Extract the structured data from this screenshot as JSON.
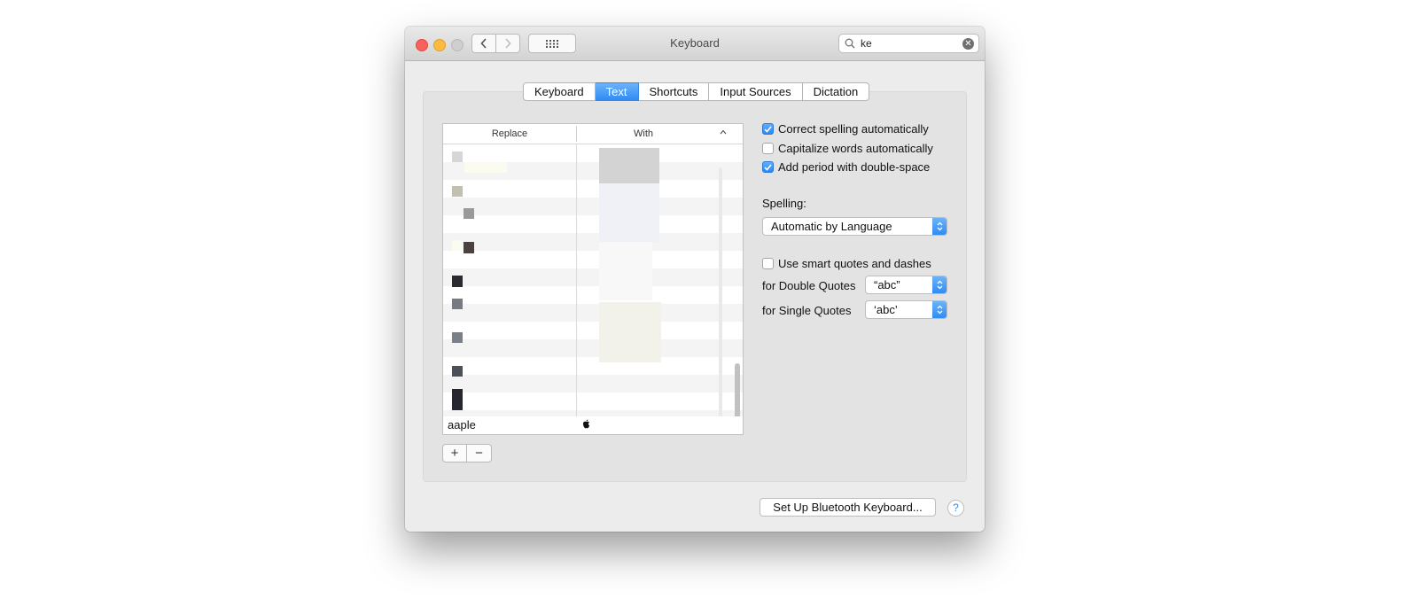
{
  "window": {
    "title": "Keyboard"
  },
  "toolbar": {
    "search_value": "ke",
    "back_icon": "chevron-left-icon",
    "forward_icon": "chevron-right-icon",
    "grid_icon": "show-all-grid-icon"
  },
  "tabs": [
    {
      "label": "Keyboard",
      "active": false
    },
    {
      "label": "Text",
      "active": true
    },
    {
      "label": "Shortcuts",
      "active": false
    },
    {
      "label": "Input Sources",
      "active": false
    },
    {
      "label": "Dictation",
      "active": false
    }
  ],
  "table": {
    "columns": [
      "Replace",
      "With"
    ],
    "last_row": {
      "replace": "aaple",
      "with_icon": "apple-logo-icon"
    }
  },
  "options": {
    "correct_spelling": {
      "label": "Correct spelling automatically",
      "checked": true
    },
    "capitalize_words": {
      "label": "Capitalize words automatically",
      "checked": false
    },
    "add_period": {
      "label": "Add period with double-space",
      "checked": true
    }
  },
  "spelling": {
    "label": "Spelling:",
    "value": "Automatic by Language"
  },
  "quotes": {
    "smart_quotes": {
      "label": "Use smart quotes and dashes",
      "checked": false
    },
    "double_label": "for Double Quotes",
    "double_value": "“abc”",
    "single_label": "for Single Quotes",
    "single_value": "‘abc’"
  },
  "buttons": {
    "bluetooth": "Set Up Bluetooth Keyboard...",
    "help": "?",
    "add": "+",
    "remove": "−"
  },
  "colors": {
    "accent": "#2f8cf4",
    "close": "#fc605c",
    "minimize": "#fdbc40"
  }
}
